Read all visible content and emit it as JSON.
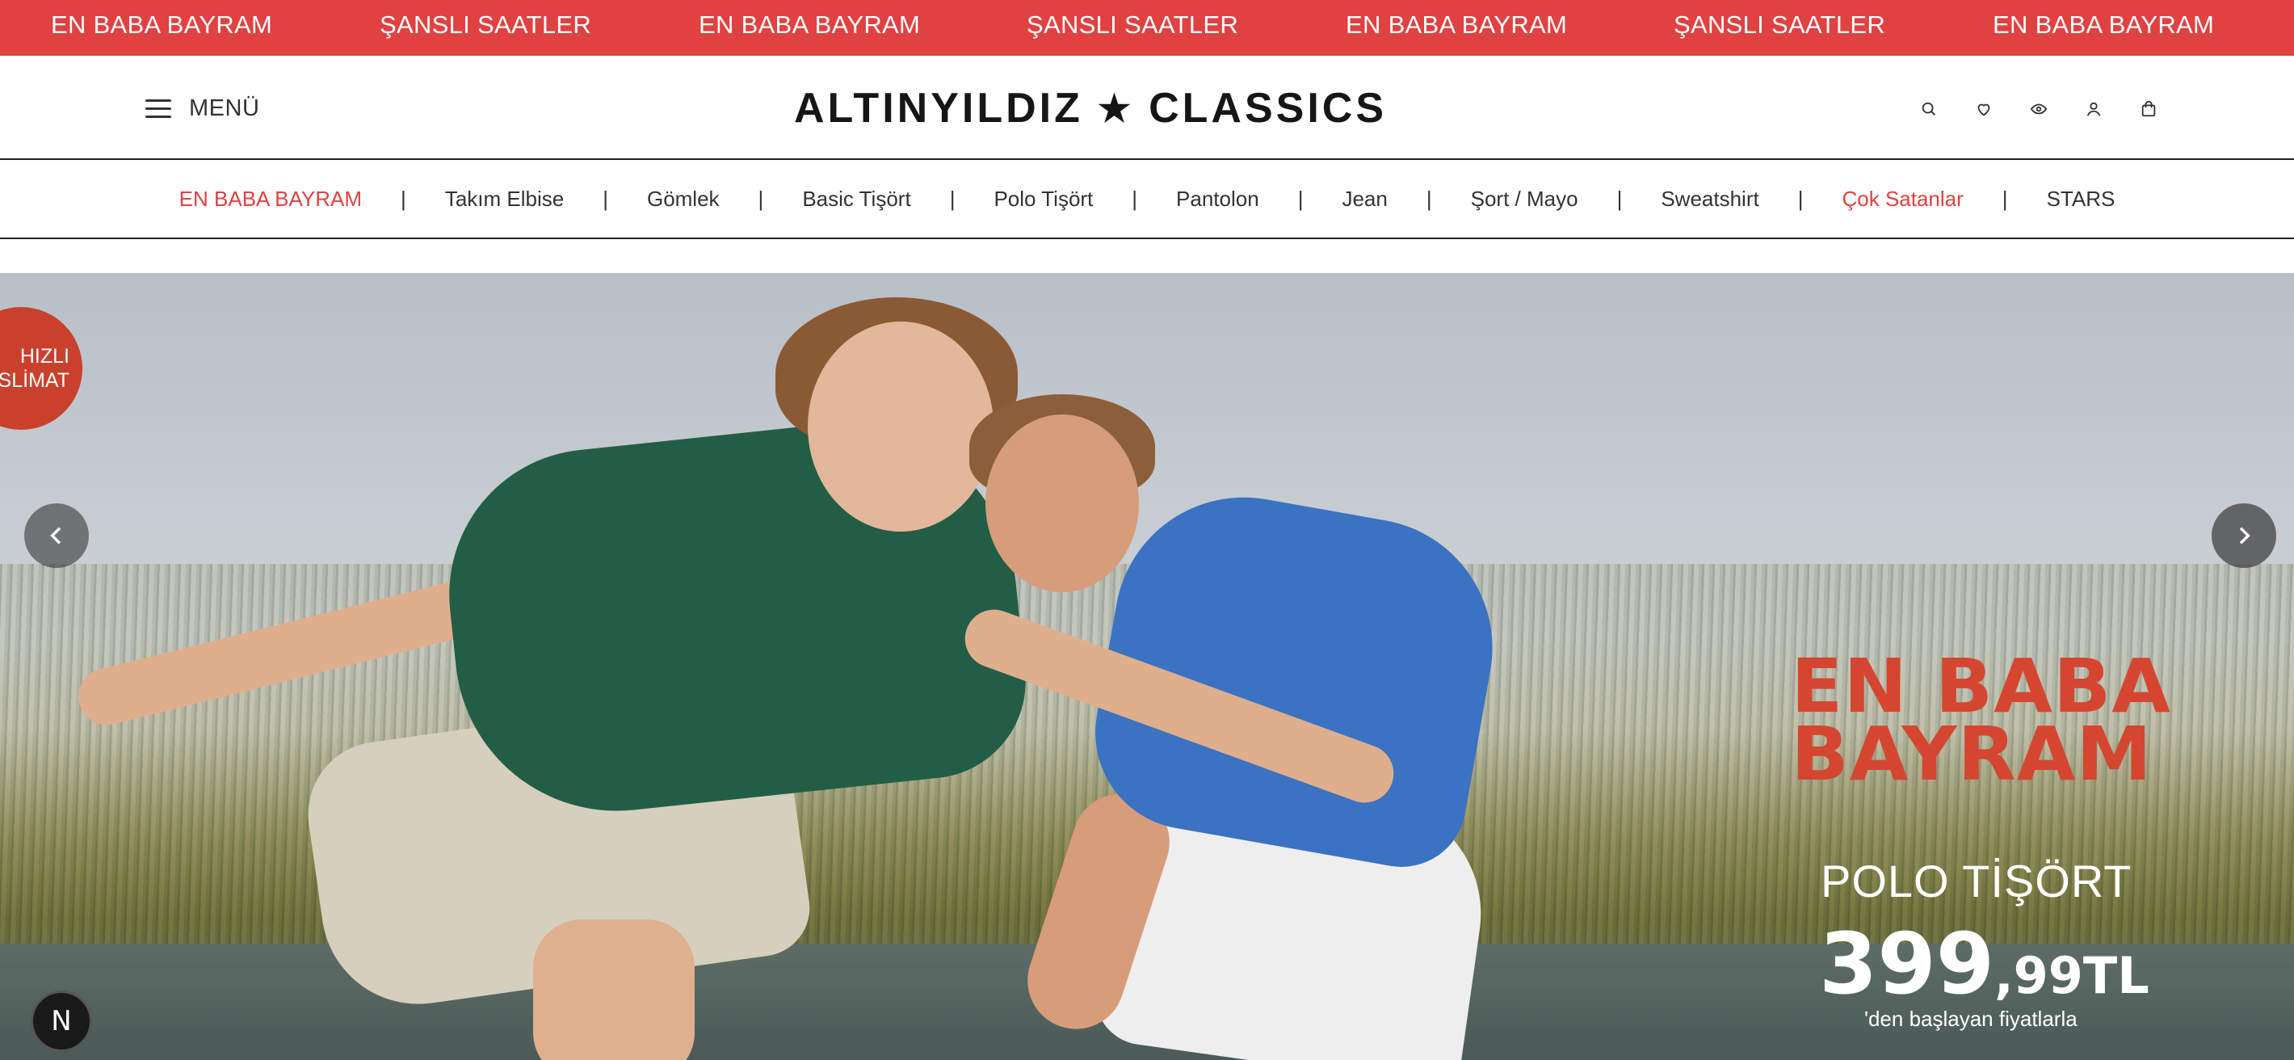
{
  "announcement": {
    "items": [
      "EN BABA BAYRAM",
      "ŞANSLI SAATLER",
      "EN BABA BAYRAM",
      "ŞANSLI SAATLER",
      "EN BABA BAYRAM",
      "ŞANSLI SAATLER",
      "EN BABA BAYRAM"
    ],
    "background_color": "#e04141"
  },
  "header": {
    "menu_label": "MENÜ",
    "logo_left": "ALTINYILDIZ",
    "logo_star": "★",
    "logo_right": "CLASSICS",
    "icons": [
      "search-icon",
      "heart-icon",
      "eye-icon",
      "user-icon",
      "bag-icon"
    ]
  },
  "categories": [
    {
      "label": "EN BABA BAYRAM",
      "highlight": true
    },
    {
      "label": "Takım Elbise",
      "highlight": false
    },
    {
      "label": "Gömlek",
      "highlight": false
    },
    {
      "label": "Basic Tişört",
      "highlight": false
    },
    {
      "label": "Polo Tişört",
      "highlight": false
    },
    {
      "label": "Pantolon",
      "highlight": false
    },
    {
      "label": "Jean",
      "highlight": false
    },
    {
      "label": "Şort / Mayo",
      "highlight": false
    },
    {
      "label": "Sweatshirt",
      "highlight": false
    },
    {
      "label": "Çok Satanlar",
      "highlight": true
    },
    {
      "label": "STARS",
      "highlight": false
    }
  ],
  "category_separator": "|",
  "hero": {
    "badge_line1": "HIZLI",
    "badge_line2": "SLİMAT",
    "title_line1": "EN BABA",
    "title_line2": "BAYRAM",
    "subtitle": "POLO TİŞÖRT",
    "price_whole": "399",
    "price_fraction": ",99TL",
    "price_note": "'den başlayan fiyatlarla",
    "accent_color": "#d54631"
  },
  "fab_label": "N"
}
